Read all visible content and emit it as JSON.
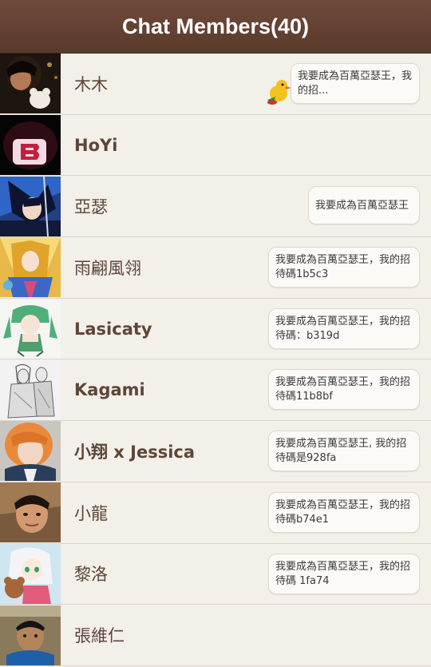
{
  "header": {
    "title": "Chat Members(40)"
  },
  "members": [
    {
      "name": "木木",
      "message": "我要成為百萬亞瑟王，我的招...",
      "sticker": "duck-sticker-icon",
      "avatar": "photo-avatar"
    },
    {
      "name": "HoYi",
      "message": "",
      "avatar": "logo-avatar"
    },
    {
      "name": "亞瑟",
      "message": "我要成為百萬亞瑟王",
      "avatar": "anime-avatar"
    },
    {
      "name": "雨翩風翎",
      "message": "我要成為百萬亞瑟王，我的招待碼1b5c3",
      "avatar": "anime-avatar"
    },
    {
      "name": "Lasicaty",
      "message": "我要成為百萬亞瑟王，我的招待碼：b319d",
      "avatar": "anime-avatar"
    },
    {
      "name": "Kagami",
      "message": "我要成為百萬亞瑟王，我的招待碼11b8bf",
      "avatar": "sketch-avatar"
    },
    {
      "name": "小翔 x Jessica",
      "message": "我要成為百萬亞瑟王, 我的招待碼是928fa",
      "avatar": "photo-avatar"
    },
    {
      "name": "小龍",
      "message": "我要成為百萬亞瑟王，我的招待碼b74e1",
      "avatar": "photo-avatar"
    },
    {
      "name": "黎洛",
      "message": "我要成為百萬亞瑟王，我的招待碼 1fa74",
      "avatar": "anime-avatar"
    },
    {
      "name": "張維仁",
      "message": "",
      "avatar": "photo-avatar"
    }
  ]
}
